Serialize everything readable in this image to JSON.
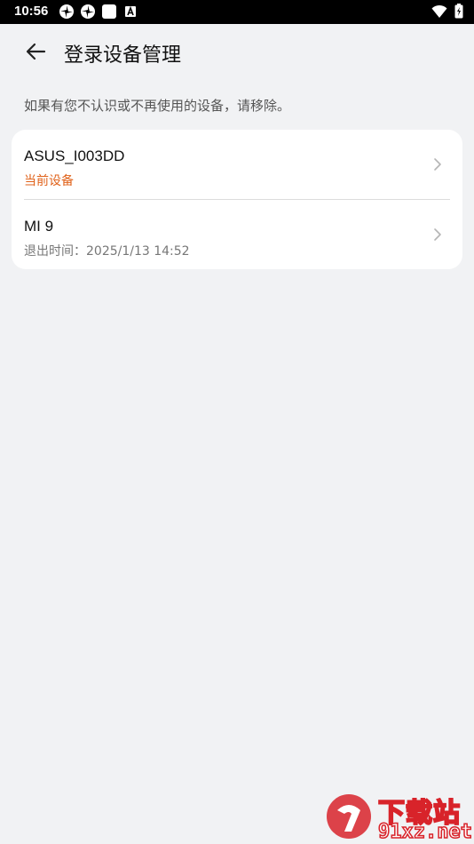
{
  "status_bar": {
    "time": "10:56",
    "icons": [
      "pinwheel-icon",
      "pinwheel-icon",
      "square-icon",
      "a-badge-icon"
    ],
    "right_icons": [
      "wifi-icon",
      "battery-charging-icon"
    ]
  },
  "header": {
    "back_icon": "arrow-left-icon",
    "title": "登录设备管理"
  },
  "hint": "如果有您不认识或不再使用的设备，请移除。",
  "devices": [
    {
      "name": "ASUS_I003DD",
      "subtitle": "当前设备",
      "subtitle_color": "#e0621a"
    },
    {
      "name": "MI 9",
      "subtitle": "退出时间：2025/1/13 14:52",
      "subtitle_color": "#777777"
    }
  ],
  "watermark": {
    "brand": "下载站",
    "url": "91xz.net",
    "color": "#d8232a"
  }
}
